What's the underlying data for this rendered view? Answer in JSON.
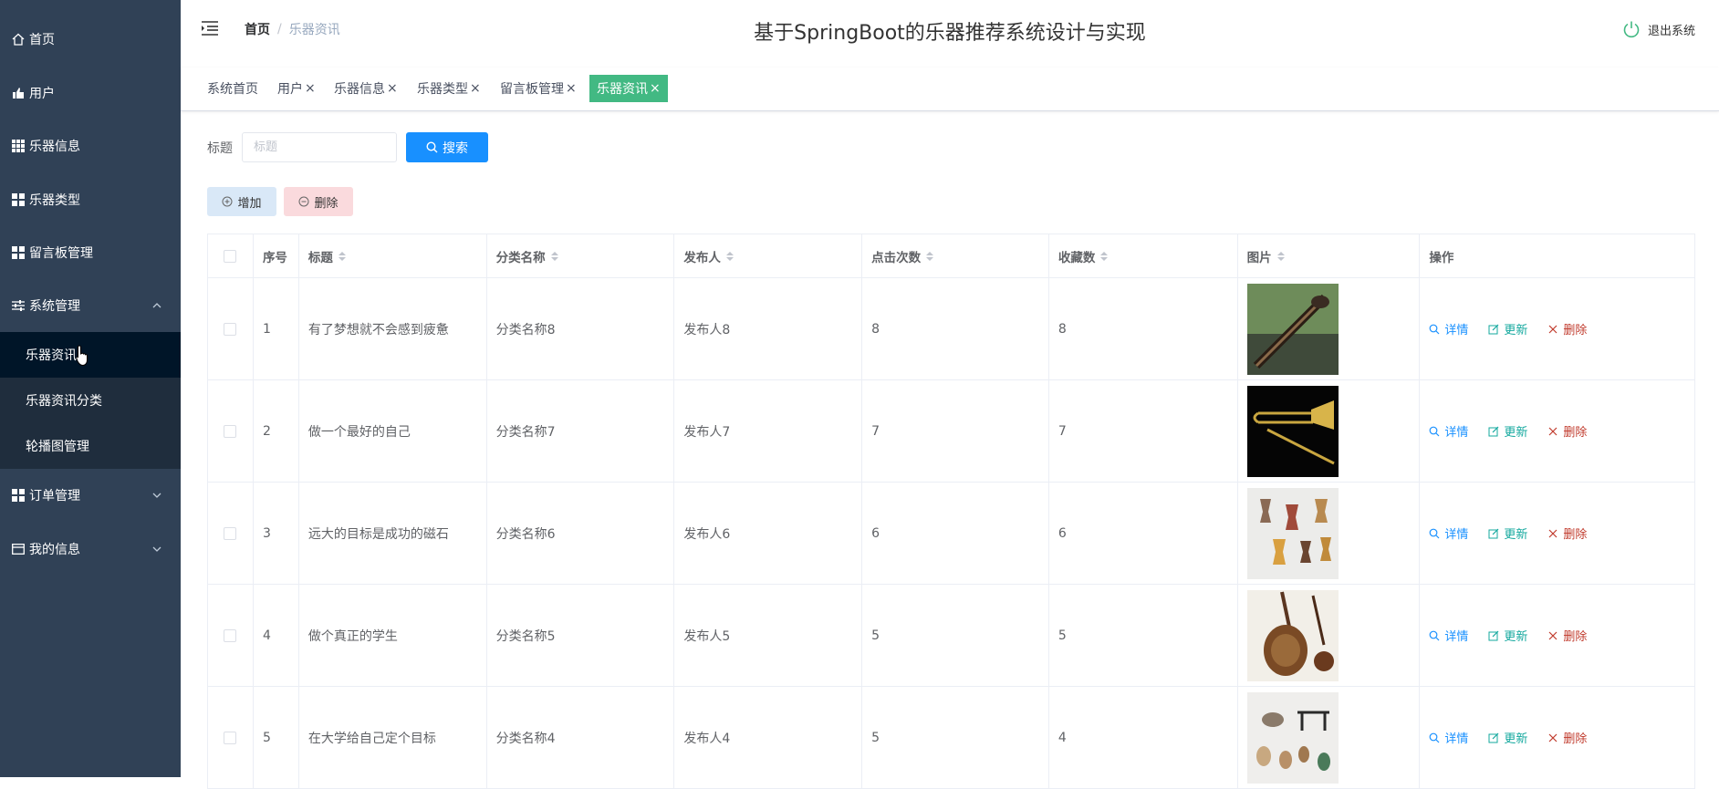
{
  "sidebar": {
    "items": [
      {
        "label": "首页",
        "icon": "home-icon"
      },
      {
        "label": "用户",
        "icon": "thumb-icon"
      },
      {
        "label": "乐器信息",
        "icon": "grid-icon"
      },
      {
        "label": "乐器类型",
        "icon": "grid-icon"
      },
      {
        "label": "留言板管理",
        "icon": "grid-icon"
      },
      {
        "label": "系统管理",
        "icon": "sliders-icon"
      },
      {
        "label": "订单管理",
        "icon": "grid-icon"
      },
      {
        "label": "我的信息",
        "icon": "card-icon"
      }
    ],
    "sub_items": [
      {
        "label": "乐器资讯",
        "active": true
      },
      {
        "label": "乐器资讯分类",
        "active": false
      },
      {
        "label": "轮播图管理",
        "active": false
      }
    ]
  },
  "header": {
    "breadcrumb_home": "首页",
    "breadcrumb_current": "乐器资讯",
    "title": "基于SpringBoot的乐器推荐系统设计与实现",
    "logout": "退出系统"
  },
  "tags": [
    {
      "label": "系统首页",
      "closable": false
    },
    {
      "label": "用户",
      "closable": true
    },
    {
      "label": "乐器信息",
      "closable": true
    },
    {
      "label": "乐器类型",
      "closable": true
    },
    {
      "label": "留言板管理",
      "closable": true
    },
    {
      "label": "乐器资讯",
      "closable": true,
      "active": true
    }
  ],
  "search": {
    "label": "标题",
    "placeholder": "标题",
    "button": "搜索"
  },
  "actions": {
    "add": "增加",
    "delete": "删除"
  },
  "table": {
    "columns": [
      "序号",
      "标题",
      "分类名称",
      "发布人",
      "点击次数",
      "收藏数",
      "图片",
      "操作"
    ],
    "rows": [
      {
        "idx": "1",
        "title": "有了梦想就不会感到疲惫",
        "category": "分类名称8",
        "publisher": "发布人8",
        "clicks": "8",
        "favorites": "8",
        "image": "hulusi-photo"
      },
      {
        "idx": "2",
        "title": "做一个最好的自己",
        "category": "分类名称7",
        "publisher": "发布人7",
        "clicks": "7",
        "favorites": "7",
        "image": "trombone-photo"
      },
      {
        "idx": "3",
        "title": "远大的目标是成功的磁石",
        "category": "分类名称6",
        "publisher": "发布人6",
        "clicks": "6",
        "favorites": "6",
        "image": "djembe-photo"
      },
      {
        "idx": "4",
        "title": "做个真正的学生",
        "category": "分类名称5",
        "publisher": "发布人5",
        "clicks": "5",
        "favorites": "5",
        "image": "sanxian-photo"
      },
      {
        "idx": "5",
        "title": "在大学给自己定个目标",
        "category": "分类名称4",
        "publisher": "发布人4",
        "clicks": "5",
        "favorites": "4",
        "image": "instruments-photo"
      }
    ],
    "ops": {
      "detail": "详情",
      "update": "更新",
      "delete": "删除"
    }
  },
  "colors": {
    "sidebar_bg": "#304156",
    "submenu_bg": "#1f2d3d",
    "tag_active": "#42b983",
    "primary": "#1890ff"
  }
}
